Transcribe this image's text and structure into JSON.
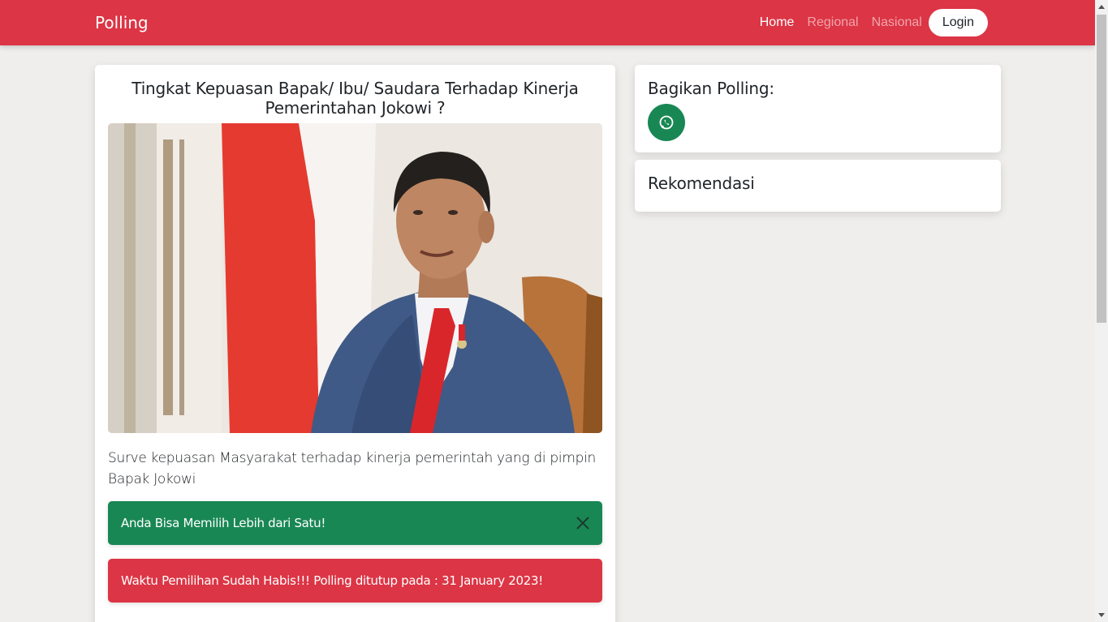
{
  "navbar": {
    "brand": "Polling",
    "links": [
      {
        "label": "Home",
        "active": true
      },
      {
        "label": "Regional",
        "active": false
      },
      {
        "label": "Nasional",
        "active": false
      }
    ],
    "login_label": "Login",
    "color": "#dc3545"
  },
  "poll": {
    "title": "Tingkat Kepuasan Bapak/ Ibu/ Saudara Terhadap Kinerja Pemerintahan Jokowi ?",
    "description": "Surve kepuasan Masyarakat terhadap kinerja pemerintah yang di pimpin Bapak Jokowi",
    "alert_success": "Anda Bisa Memilih Lebih dari Satu!",
    "alert_danger": "Waktu Pemilihan Sudah Habis!!! Polling ditutup pada : 31 January 2023!"
  },
  "sidebar": {
    "share_heading": "Bagikan Polling:",
    "share_icon": "whatsapp-icon",
    "recommend_heading": "Rekomendasi"
  },
  "colors": {
    "success": "#198754",
    "danger": "#dc3545",
    "background": "#efeeec"
  }
}
